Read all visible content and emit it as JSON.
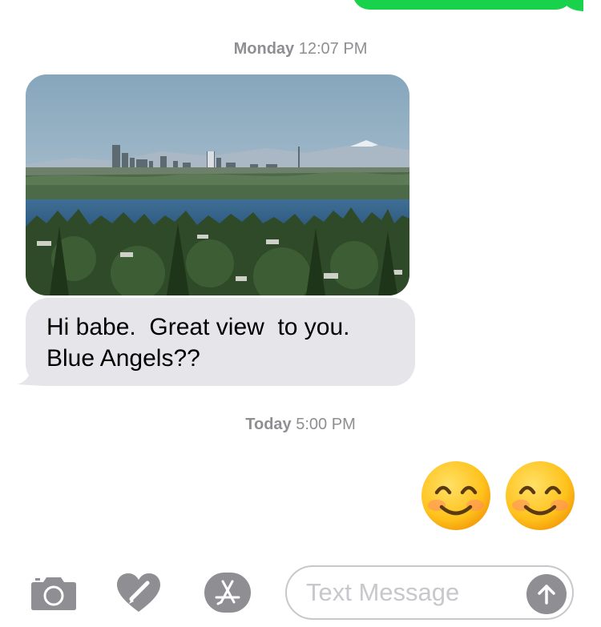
{
  "conversation": {
    "messages": [
      {
        "timestamp_day": "Monday",
        "timestamp_time": "12:07 PM",
        "photo_icon": "photo-city-skyline-lake",
        "text_lines": [
          "Hi babe.  Great view  to you.",
          "Blue Angels??"
        ]
      },
      {
        "timestamp_day": "Today",
        "timestamp_time": "5:00 PM",
        "emoji": [
          "😊",
          "😊"
        ],
        "emoji_icon": "smiling-face-emoji"
      }
    ]
  },
  "toolbar": {
    "camera_icon": "camera-icon",
    "digital_touch_icon": "heart-digital-touch-icon",
    "app_store_icon": "app-store-icon",
    "placeholder": "Text Message",
    "send_icon": "arrow-up-icon"
  },
  "colors": {
    "sent_bubble": "#19d24b",
    "received_bubble": "#e5e5ea",
    "timestamp_text": "#8e8e93",
    "toolbar_icon": "#8e8e93",
    "placeholder_text": "#c7c7cc"
  }
}
